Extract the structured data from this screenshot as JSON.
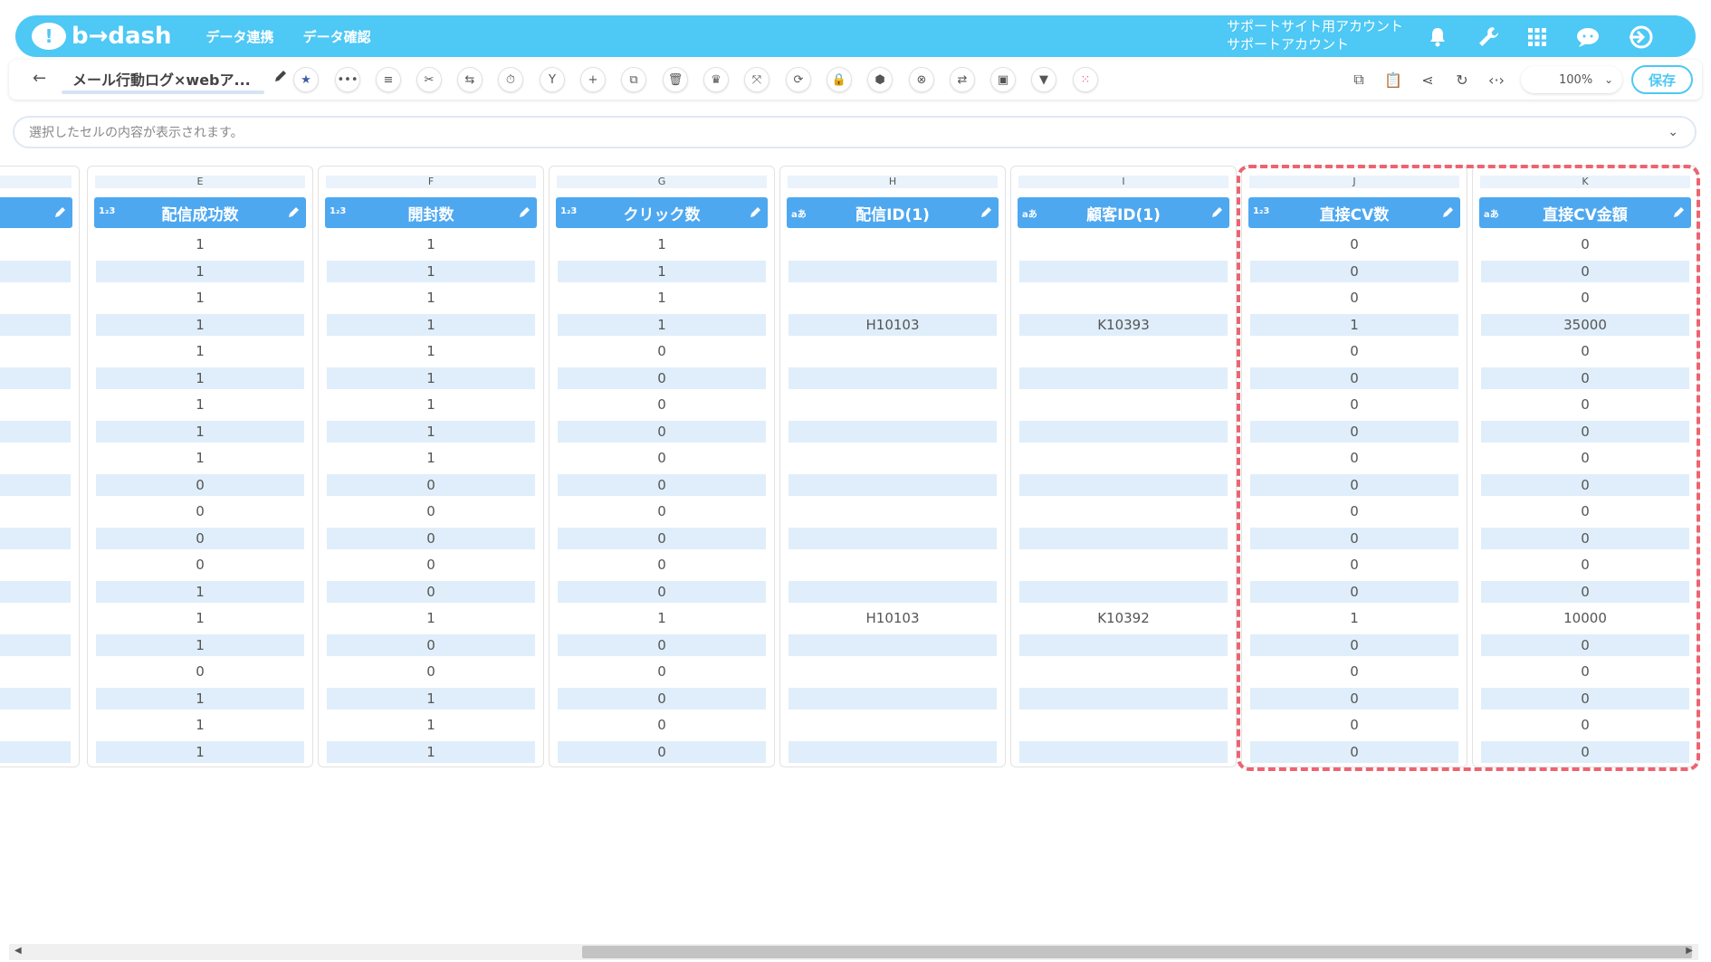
{
  "header": {
    "logo_text": "b→dash",
    "nav": [
      "データ連携",
      "データ確認"
    ],
    "account_line1": "サポートサイト用アカウント",
    "account_line2": "サポートアカウント"
  },
  "toolbar": {
    "title": "メール行動ログ×webア...",
    "zoom": "100%",
    "save_label": "保存"
  },
  "cellbar": {
    "placeholder": "選択したセルの内容が表示されます。"
  },
  "columns": [
    {
      "letter": "E",
      "name": "配信成功数",
      "type": "1₂3",
      "values": [
        "1",
        "1",
        "1",
        "1",
        "1",
        "1",
        "1",
        "1",
        "1",
        "0",
        "0",
        "0",
        "0",
        "1",
        "1",
        "1",
        "0",
        "1",
        "1",
        "1"
      ]
    },
    {
      "letter": "F",
      "name": "開封数",
      "type": "1₂3",
      "values": [
        "1",
        "1",
        "1",
        "1",
        "1",
        "1",
        "1",
        "1",
        "1",
        "0",
        "0",
        "0",
        "0",
        "0",
        "1",
        "0",
        "0",
        "1",
        "1",
        "1"
      ]
    },
    {
      "letter": "G",
      "name": "クリック数",
      "type": "1₂3",
      "values": [
        "1",
        "1",
        "1",
        "1",
        "0",
        "0",
        "0",
        "0",
        "0",
        "0",
        "0",
        "0",
        "0",
        "0",
        "1",
        "0",
        "0",
        "0",
        "0",
        "0"
      ]
    },
    {
      "letter": "H",
      "name": "配信ID(1)",
      "type": "aあ",
      "values": [
        "",
        "",
        "",
        "H10103",
        "",
        "",
        "",
        "",
        "",
        "",
        "",
        "",
        "",
        "",
        "H10103",
        "",
        "",
        "",
        "",
        ""
      ]
    },
    {
      "letter": "I",
      "name": "顧客ID(1)",
      "type": "aあ",
      "values": [
        "",
        "",
        "",
        "K10393",
        "",
        "",
        "",
        "",
        "",
        "",
        "",
        "",
        "",
        "",
        "K10392",
        "",
        "",
        "",
        "",
        ""
      ]
    },
    {
      "letter": "J",
      "name": "直接CV数",
      "type": "1₂3",
      "values": [
        "0",
        "0",
        "0",
        "1",
        "0",
        "0",
        "0",
        "0",
        "0",
        "0",
        "0",
        "0",
        "0",
        "0",
        "1",
        "0",
        "0",
        "0",
        "0",
        "0"
      ]
    },
    {
      "letter": "K",
      "name": "直接CV金額",
      "type": "aあ",
      "values": [
        "0",
        "0",
        "0",
        "35000",
        "0",
        "0",
        "0",
        "0",
        "0",
        "0",
        "0",
        "0",
        "0",
        "0",
        "10000",
        "0",
        "0",
        "0",
        "0",
        "0"
      ]
    }
  ]
}
